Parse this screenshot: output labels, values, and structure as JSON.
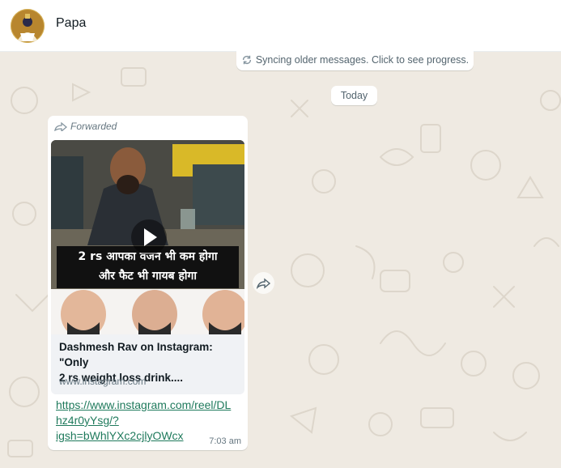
{
  "header": {
    "contact_name": "Papa"
  },
  "sync": {
    "text": "Syncing older messages. Click to see progress."
  },
  "date_divider": {
    "label": "Today"
  },
  "message": {
    "forwarded_label": "Forwarded",
    "preview": {
      "caption_line1": "2 rs आपका वजन भी कम होगा",
      "caption_line2": "और फैट भी गायब होगा",
      "title_line1": "Dashmesh Rav on Instagram: \"Only",
      "title_line2": "2 rs weight loss drink....",
      "domain": "www.instagram.com"
    },
    "link_lines": [
      "https://www.instagram.com/reel/DL",
      "hz4r0yYsg/?",
      "igsh=bWhlYXc2cjlyOWcx"
    ],
    "time": "7:03 am"
  },
  "icons": [
    "avatar",
    "sync-icon",
    "forward-icon",
    "play-icon",
    "forward-button-icon"
  ]
}
